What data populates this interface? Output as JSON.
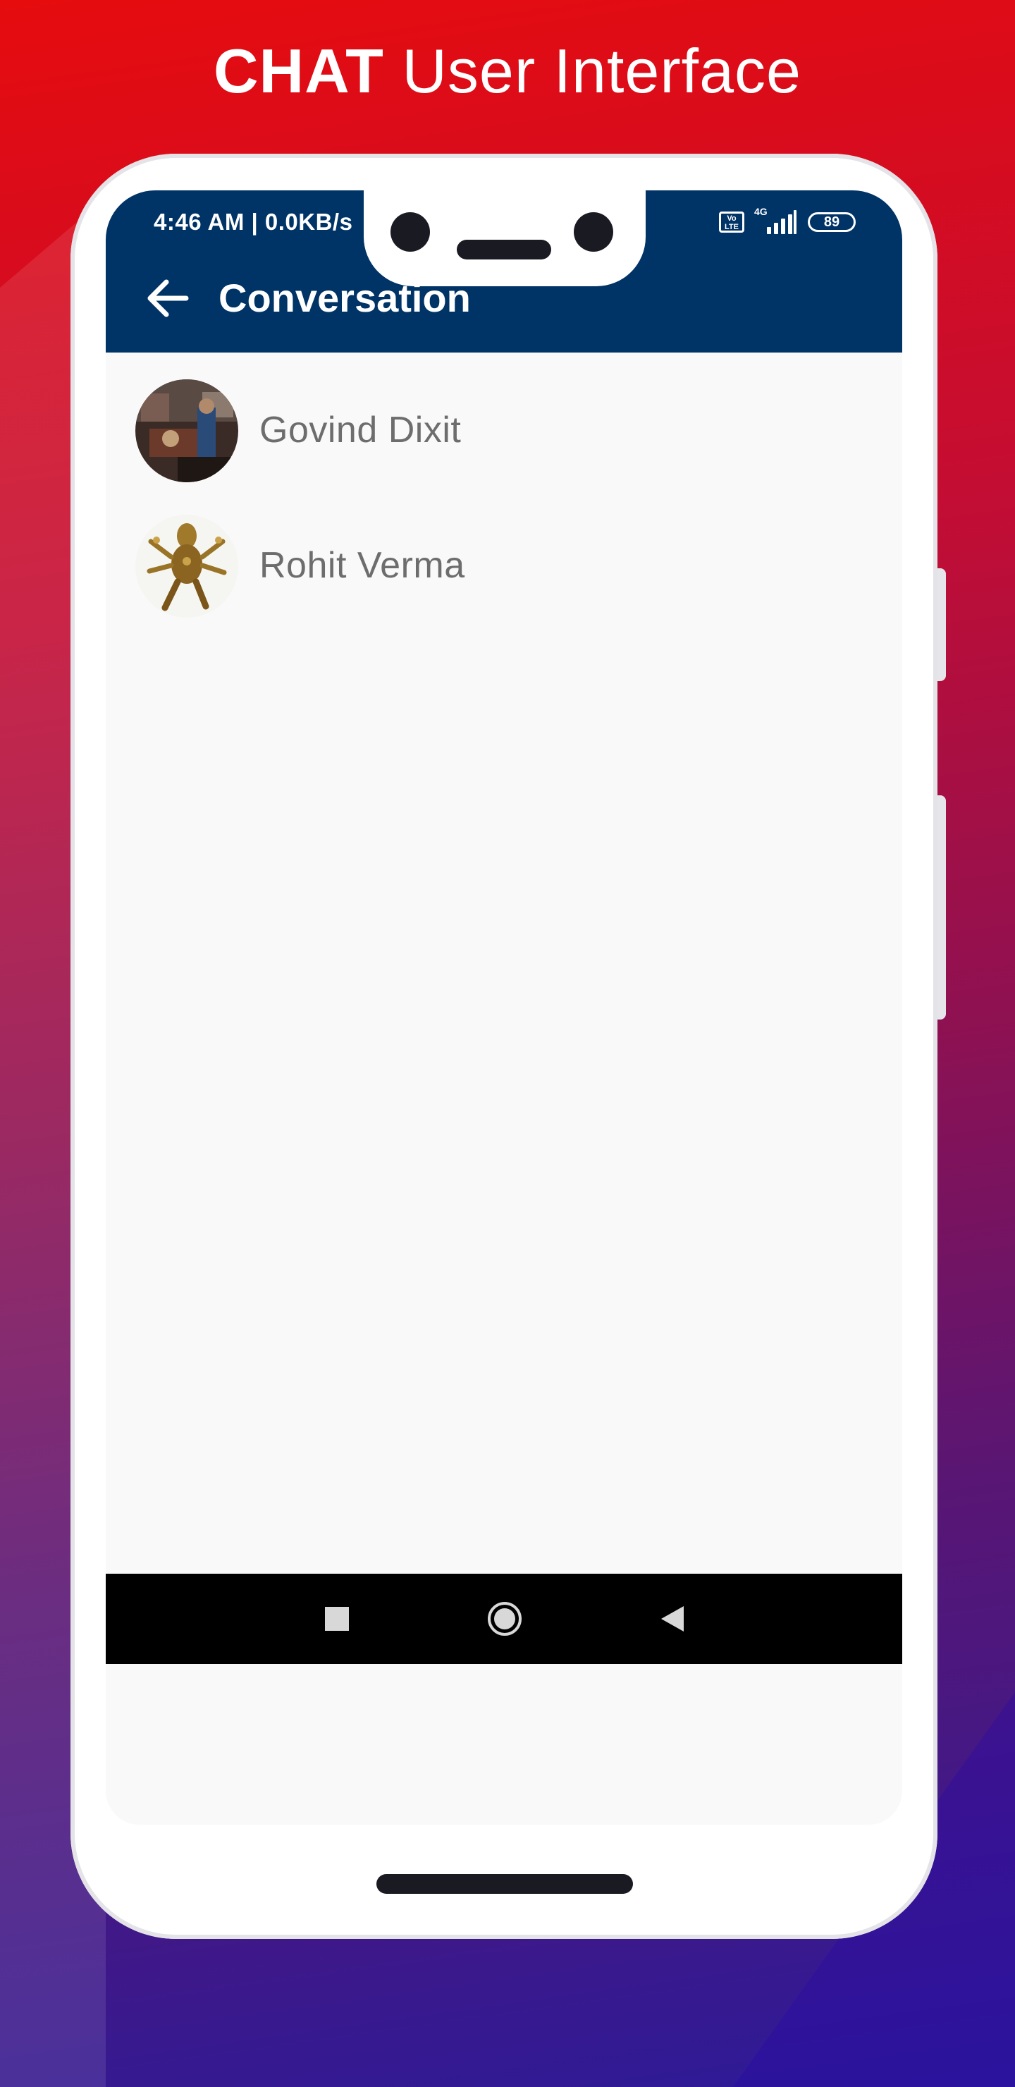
{
  "headline": {
    "bold": "CHAT",
    "light": "User Interface"
  },
  "status_bar": {
    "time": "4:46 AM | 0.0KB/s",
    "volte_label": "Vo LTE",
    "network_label": "4G",
    "battery_level": "89"
  },
  "app_bar": {
    "title": "Conversation"
  },
  "conversations": [
    {
      "name": "Govind Dixit"
    },
    {
      "name": "Rohit Verma"
    }
  ],
  "colors": {
    "app_bar": "#003366",
    "list_background": "#f9f9f9",
    "name_text": "#6d6d6d",
    "nav_bar": "#000000"
  },
  "icons": {
    "back": "arrow-left-icon",
    "recent_apps": "square-icon",
    "home": "circle-icon",
    "system_back": "triangle-left-icon"
  }
}
